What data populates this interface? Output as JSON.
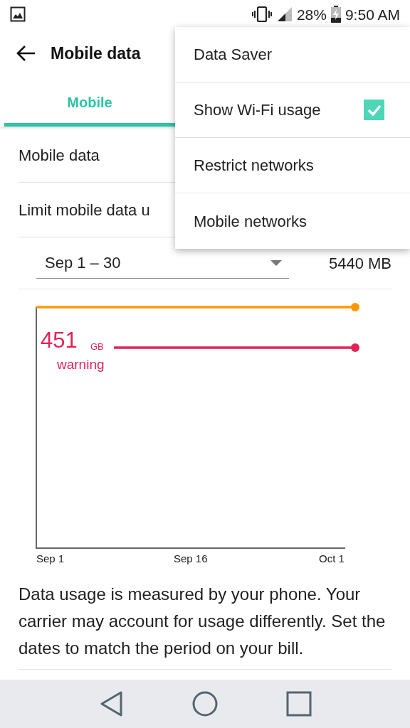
{
  "status_bar": {
    "battery": "28%",
    "time": "9:50 AM"
  },
  "toolbar": {
    "title": "Mobile data"
  },
  "tabs": [
    {
      "label": "Mobile",
      "selected": true
    }
  ],
  "rows": [
    {
      "label": "Mobile data"
    },
    {
      "label": "Limit mobile data u"
    }
  ],
  "cycle": {
    "value": "Sep 1 – 30",
    "usage": "5440 MB"
  },
  "chart": {
    "warning": {
      "value": "451",
      "unit": "GB",
      "label": "warning"
    },
    "x_labels": [
      "Sep 1",
      "Sep 16",
      "Oct 1"
    ]
  },
  "note": "Data usage is measured by your phone. Your carrier may account for usage differently. Set the dates to match the period on your bill.",
  "menu": [
    {
      "kind": "item",
      "label": "Data Saver"
    },
    {
      "kind": "checkbox",
      "label": "Show Wi-Fi usage",
      "checked": true
    },
    {
      "kind": "item",
      "label": "Restrict networks"
    },
    {
      "kind": "item",
      "label": "Mobile networks"
    }
  ]
}
